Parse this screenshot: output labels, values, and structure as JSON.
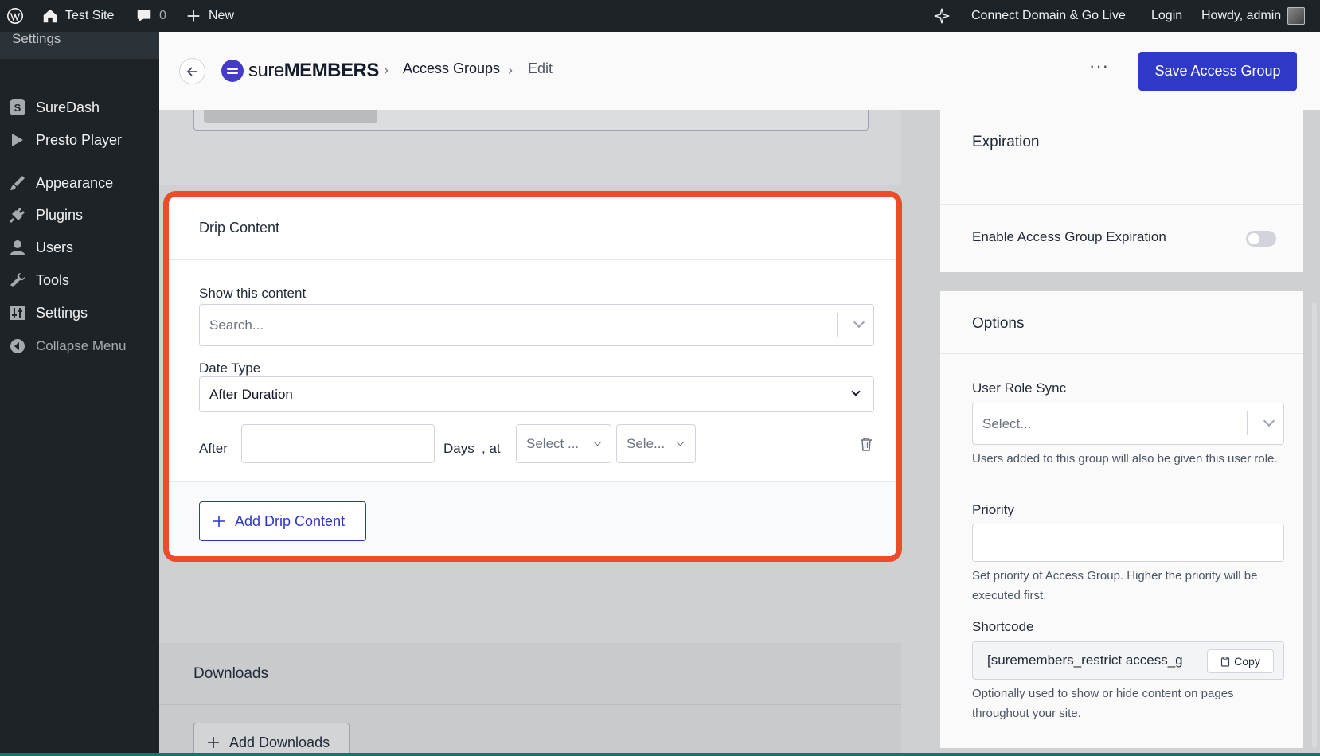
{
  "admin_bar": {
    "site_name": "Test Site",
    "comments_count": "0",
    "new_label": "New",
    "connect_label": "Connect Domain & Go Live",
    "login_label": "Login",
    "howdy_label": "Howdy, admin"
  },
  "sidebar": {
    "top_label": "Settings",
    "items": [
      {
        "label": "SureDash",
        "icon": "suredash-icon"
      },
      {
        "label": "Presto Player",
        "icon": "play-icon"
      },
      {
        "label": "Appearance",
        "icon": "brush-icon"
      },
      {
        "label": "Plugins",
        "icon": "plug-icon"
      },
      {
        "label": "Users",
        "icon": "user-icon"
      },
      {
        "label": "Tools",
        "icon": "wrench-icon"
      },
      {
        "label": "Settings",
        "icon": "sliders-icon"
      },
      {
        "label": "Collapse Menu",
        "icon": "collapse-icon"
      }
    ]
  },
  "header": {
    "brand_light": "sure",
    "brand_bold": "MEMBERS",
    "breadcrumb_1": "Access Groups",
    "breadcrumb_2": "Edit",
    "more_label": "···",
    "save_label": "Save Access Group"
  },
  "drip": {
    "title": "Drip Content",
    "show_label": "Show this content",
    "search_placeholder": "Search...",
    "date_type_label": "Date Type",
    "date_type_value": "After Duration",
    "after_label": "After",
    "days_label": "Days",
    "at_label": ", at",
    "select1_placeholder": "Select ...",
    "select2_placeholder": "Sele...",
    "add_label": "Add Drip Content"
  },
  "downloads": {
    "title": "Downloads",
    "add_label": "Add Downloads"
  },
  "expiration": {
    "title": "Expiration",
    "enable_label": "Enable Access Group Expiration"
  },
  "options": {
    "title": "Options",
    "role_sync_label": "User Role Sync",
    "role_sync_placeholder": "Select...",
    "role_sync_help": "Users added to this group will also be given this user role.",
    "priority_label": "Priority",
    "priority_help": "Set priority of Access Group. Higher the priority will be executed first.",
    "shortcode_label": "Shortcode",
    "shortcode_value": "[suremembers_restrict access_g",
    "copy_label": "Copy",
    "shortcode_help": "Optionally used to show or hide content on pages throughout your site."
  },
  "colors": {
    "accent": "#2b37c8",
    "highlight": "#ee4b2b",
    "admin_bar": "#1d2327"
  }
}
